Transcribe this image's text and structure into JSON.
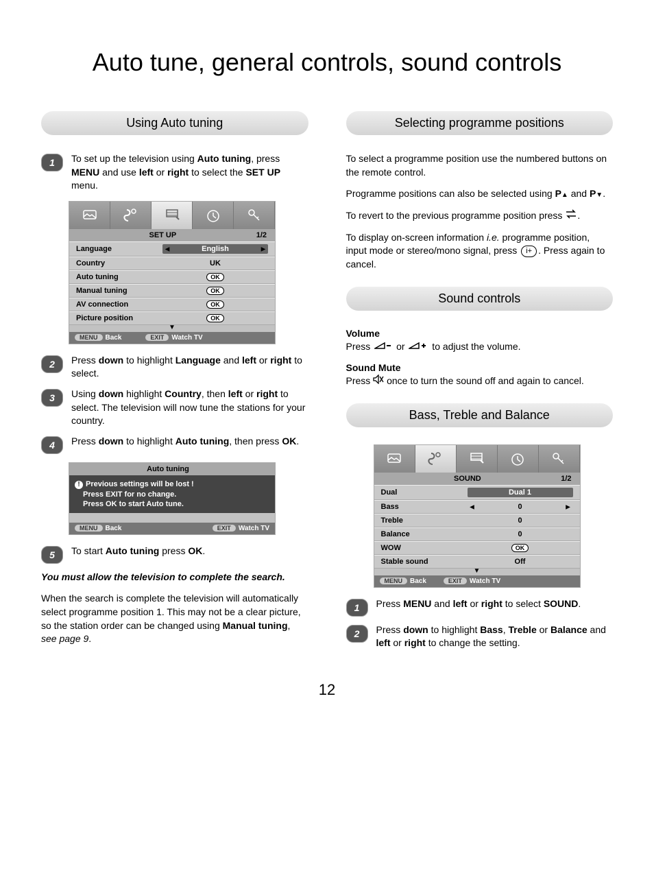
{
  "page_title": "Auto tune, general controls, sound controls",
  "page_number": "12",
  "left": {
    "heading": "Using Auto tuning",
    "step1": "To set up the television using <b>Auto tuning</b>, press <b>MENU</b> and use <b>left</b> or <b>right</b> to select the <b>SET UP</b> menu.",
    "osd1": {
      "title": "SET UP",
      "page": "1/2",
      "rows": [
        {
          "label": "Language",
          "value": "English",
          "arrows": true,
          "selected": true
        },
        {
          "label": "Country",
          "value": "UK"
        },
        {
          "label": "Auto tuning",
          "value": "OK",
          "ok": true
        },
        {
          "label": "Manual tuning",
          "value": "OK",
          "ok": true
        },
        {
          "label": "AV connection",
          "value": "OK",
          "ok": true
        },
        {
          "label": "Picture position",
          "value": "OK",
          "ok": true
        }
      ],
      "footer": {
        "menu": "MENU",
        "back": "Back",
        "exit": "EXIT",
        "watch": "Watch TV"
      }
    },
    "step2": "Press <b>down</b> to highlight <b>Language</b> and <b>left</b> or <b>right</b> to select.",
    "step3": "Using <b>down</b> highlight <b>Country</b>, then <b>left</b> or <b>right</b> to select. The television will now tune the stations for your country.",
    "step4": "Press <b>down</b> to highlight <b>Auto tuning</b>, then press <b>OK</b>.",
    "osd2": {
      "title": "Auto tuning",
      "lines": [
        "Previous settings will be lost  !",
        "Press EXIT for no change.",
        "Press OK to start Auto tune."
      ],
      "footer": {
        "menu": "MENU",
        "back": "Back",
        "exit": "EXIT",
        "watch": "Watch TV"
      }
    },
    "step5": "To start <b>Auto tuning</b> press <b>OK</b>.",
    "note_bold": "You must allow the television to complete the search.",
    "closing": "When the search is complete the television will automatically select programme position 1. This may not be a clear picture, so the station order can be changed using <b>Manual tuning</b>, <i>see page 9</i>."
  },
  "right": {
    "heading1": "Selecting programme positions",
    "para1": "To select a programme position use the numbered buttons on the remote control.",
    "para2_a": "Programme positions can also be selected using ",
    "para2_b": " and ",
    "para2_c": ".",
    "para3_a": "To revert to the previous programme position press ",
    "para3_b": ".",
    "para4_a": "To display on-screen information <i>i.e.</i> programme position, input mode or stereo/mono signal, press ",
    "para4_b": ". Press again to cancel.",
    "heading2": "Sound controls",
    "vol_head": "Volume",
    "vol_text_a": "Press ",
    "vol_text_b": " or ",
    "vol_text_c": " to adjust the volume.",
    "mute_head": "Sound Mute",
    "mute_text_a": "Press ",
    "mute_text_b": " once to turn the sound off and again to cancel.",
    "heading3": "Bass, Treble and Balance",
    "osd3": {
      "title": "SOUND",
      "page": "1/2",
      "rows": [
        {
          "label": "Dual",
          "value": "Dual 1",
          "selected": true
        },
        {
          "label": "Bass",
          "value": "0",
          "arrows": true
        },
        {
          "label": "Treble",
          "value": "0"
        },
        {
          "label": "Balance",
          "value": "0"
        },
        {
          "label": "WOW",
          "value": "OK",
          "ok": true
        },
        {
          "label": "Stable sound",
          "value": "Off"
        }
      ],
      "footer": {
        "menu": "MENU",
        "back": "Back",
        "exit": "EXIT",
        "watch": "Watch TV"
      }
    },
    "rstep1": "Press <b>MENU</b> and <b>left</b> or <b>right</b> to select <b>SOUND</b>.",
    "rstep2": "Press <b>down</b> to highlight <b>Bass</b>, <b>Treble</b> or <b>Balance</b> and <b>left</b> or <b>right</b> to change the setting."
  }
}
